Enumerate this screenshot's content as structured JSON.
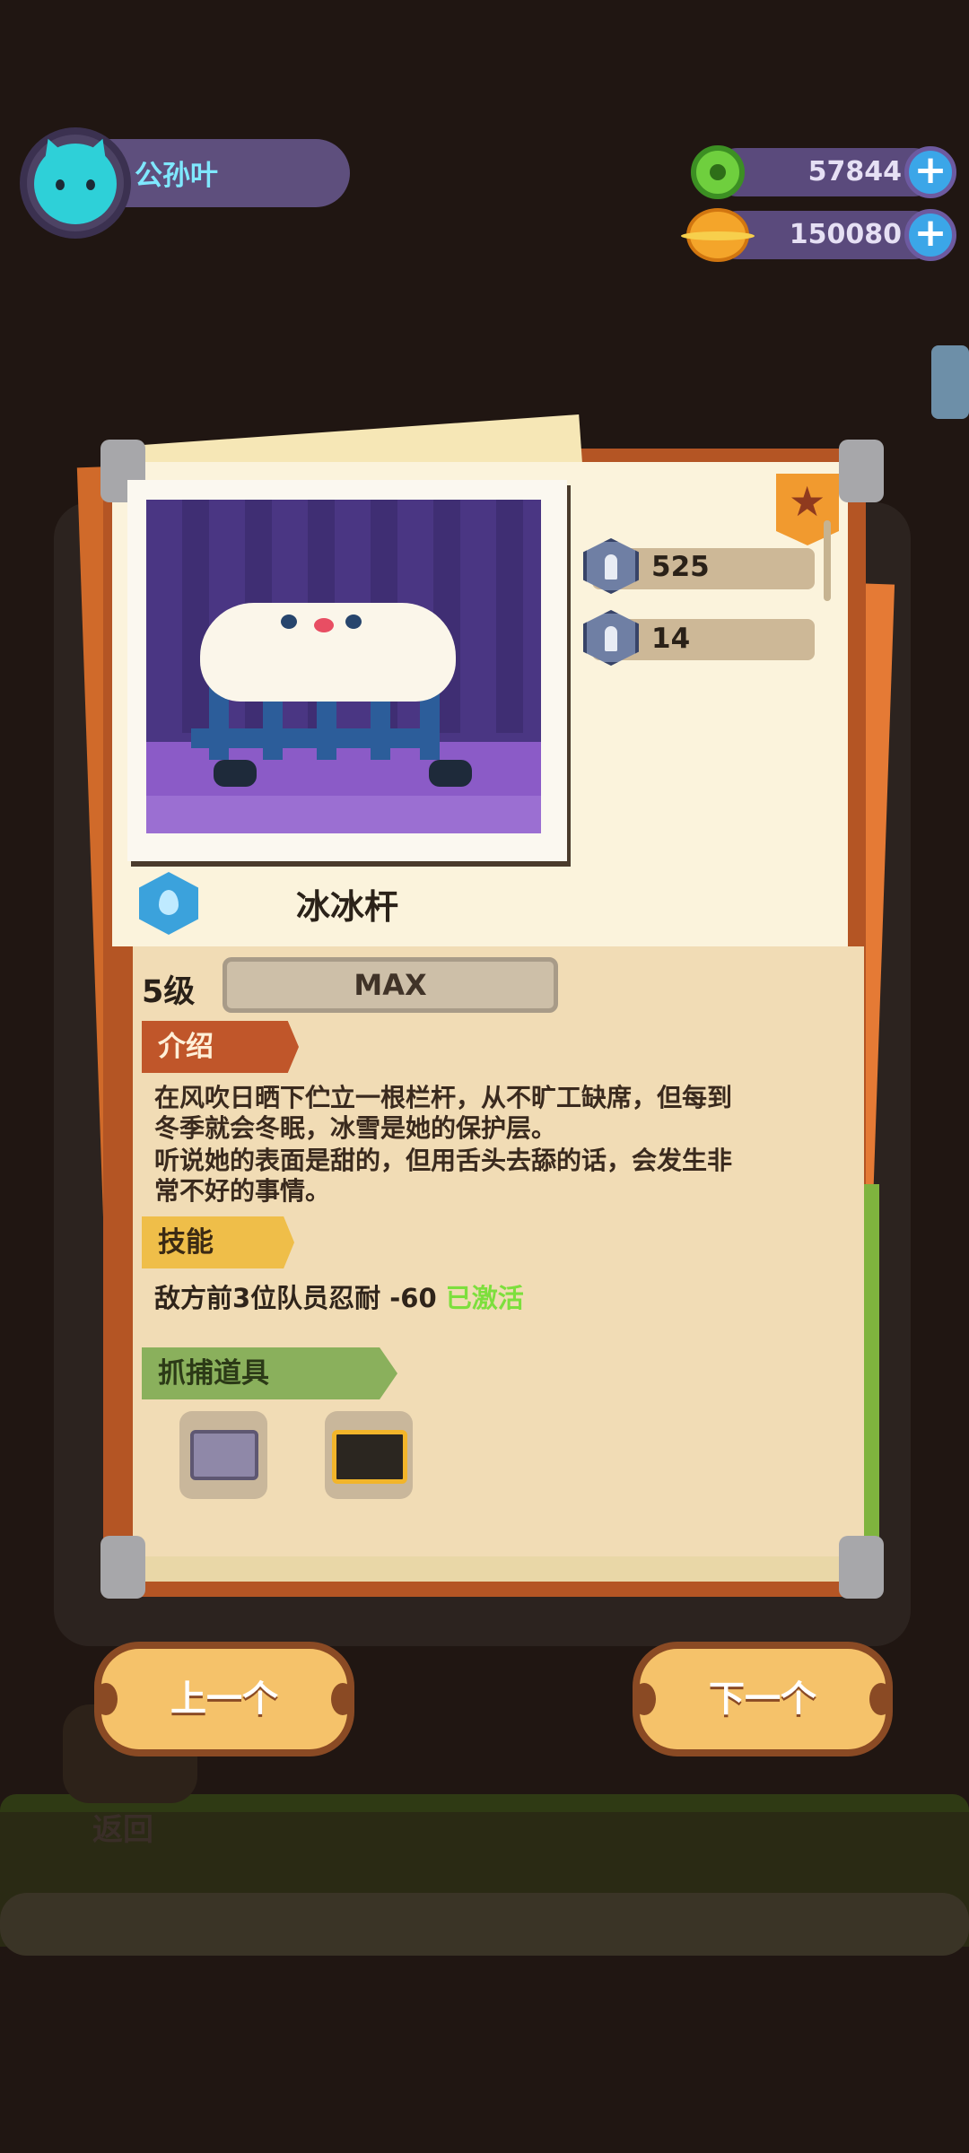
{
  "player": {
    "name": "公孙叶",
    "avatar_icon": "cat-avatar-icon"
  },
  "resources": [
    {
      "icon": "green-gem-icon",
      "value": "57844"
    },
    {
      "icon": "gold-coin-icon",
      "value": "150080"
    }
  ],
  "card": {
    "stats": [
      {
        "icon": "attack-stat-icon",
        "value": "525"
      },
      {
        "icon": "defense-stat-icon",
        "value": "14"
      }
    ],
    "character_name": "冰冰杆",
    "element_icon": "water-drop-icon",
    "level": "5级",
    "level_bar": "MAX",
    "intro_label": "介绍",
    "intro_lines": [
      "在风吹日晒下伫立一根栏杆，从不旷工缺席，但每到",
      "冬季就会冬眠，冰雪是她的保护层。",
      "听说她的表面是甜的，但用舌头去舔的话，会发生非",
      "常不好的事情。"
    ],
    "skill_label": "技能",
    "skill_text": "敌方前3位队员忍耐 -60",
    "skill_status": "已激活",
    "tools_label": "抓捕道具",
    "tools": [
      "gray-toolbox-icon",
      "gold-toolbox-icon"
    ]
  },
  "nav": {
    "prev": "上一个",
    "next": "下一个",
    "back": "返回"
  },
  "colors": {
    "skill_active": "#7ddf3d",
    "ribbon_intro": "#c0562a",
    "ribbon_skill": "#efbe49",
    "ribbon_tools": "#8ab05c"
  }
}
